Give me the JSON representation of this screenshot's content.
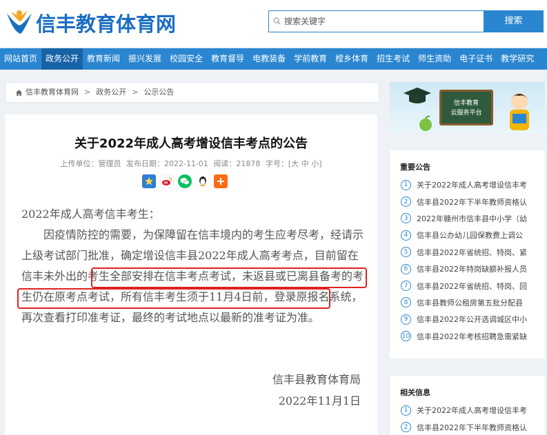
{
  "site": {
    "logo_text": "信丰教育体育网"
  },
  "search": {
    "placeholder": "搜索关键字",
    "button": "搜索"
  },
  "nav": [
    "网站首页",
    "政务公开",
    "教育新闻",
    "振兴发展",
    "校园安全",
    "教育督导",
    "电教装备",
    "学前教育",
    "樘乡体育",
    "招生考试",
    "师生资助",
    "电子证书",
    "教学研究"
  ],
  "nav_active": "政务公开",
  "breadcrumb": {
    "home": "信丰教育体育网",
    "sep": ">",
    "level2": "政务公开",
    "level3": "公示公告"
  },
  "article": {
    "title": "关于2022年成人高考增设信丰考点的公告",
    "meta": {
      "uploader": "上传单位：管理员",
      "date": "发布日期：2022-11-01",
      "views": "阅读：21878",
      "fontsize": "字号：[大 中 小]"
    },
    "greeting": "2022年成人高考信丰考生：",
    "paragraph": "因疫情防控的需要，为保障留在信丰境内的考生应考尽考，经请示上级考试部门批准，确定增设信丰县2022年成人高考考点，目前留在信丰未外出的考生全部安排在信丰考点考试，未返县或已离县备考的考生仍在原考点考试，所有信丰考生须于11月4日前，登录原报名系统，再次查看打印准考证，最终的考试地点以最新的准考证为准。",
    "signature_org": "信丰县教育体育局",
    "signature_date": "2022年11月1日"
  },
  "banner": {
    "line1": "信丰教育",
    "line2": "云服务平台"
  },
  "important": {
    "heading": "重要公告",
    "items": [
      "关于2022年成人高考增设信丰考",
      "信丰县2022年下半年教师资格认",
      "2022年赣州市信丰县中小学（幼",
      "信丰县公办幼儿园保教费上调公",
      "信丰县2022年省统招、特岗、紧",
      "信丰县2022年特岗缺额补报人员",
      "信丰县2022年省统招、特岗、回",
      "信丰县教师公租房第五批分配县",
      "信丰县2022年公开选调城区中小",
      "信丰县2022年考核招聘急需紧缺"
    ]
  },
  "related": {
    "heading": "相关信息",
    "items": [
      "关于2022年成人高考增设信丰考",
      "信丰县2022年下半年教师资格认"
    ]
  },
  "colors": {
    "primary": "#2a86d0",
    "nav_active": "#1863a8",
    "highlight": "#e02020"
  }
}
